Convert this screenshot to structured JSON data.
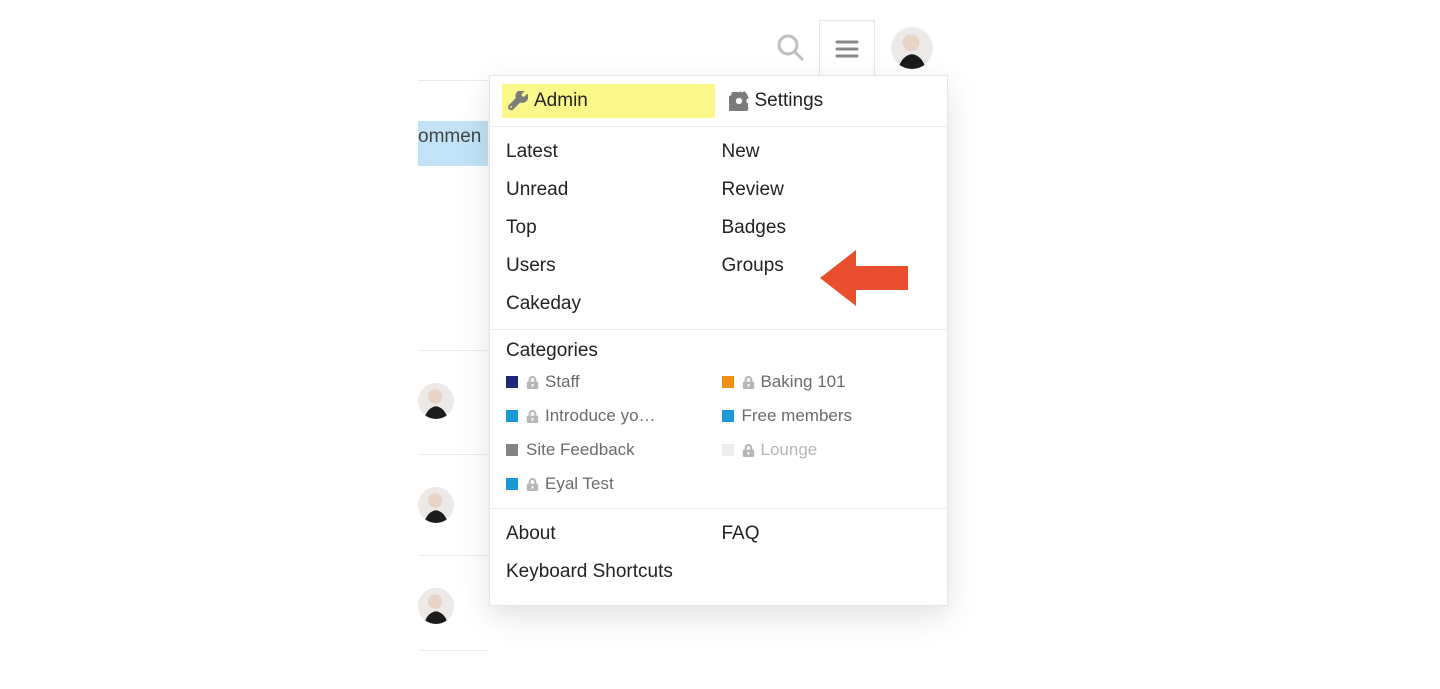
{
  "background": {
    "pill_text": "ommen",
    "row_dividers": [
      350,
      454,
      555,
      650
    ]
  },
  "header": {
    "search_icon": "search-icon",
    "menu_icon": "hamburger-icon",
    "avatar_icon": "user-avatar"
  },
  "panel": {
    "top": {
      "admin_icon": "wrench-icon",
      "admin_label": "Admin",
      "settings_icon": "gear-icon",
      "settings_label": "Settings"
    },
    "nav_left": [
      "Latest",
      "Unread",
      "Top",
      "Users",
      "Cakeday"
    ],
    "nav_right": [
      "New",
      "Review",
      "Badges",
      "Groups"
    ],
    "categories_heading": "Categories",
    "categories_left": [
      {
        "color": "#23247c",
        "locked": true,
        "label": "Staff"
      },
      {
        "color": "#1899d6",
        "locked": true,
        "label": "Introduce yo…"
      },
      {
        "color": "#848484",
        "locked": false,
        "label": "Site Feedback"
      },
      {
        "color": "#1899d6",
        "locked": true,
        "label": "Eyal Test"
      }
    ],
    "categories_right": [
      {
        "color": "#f09015",
        "locked": true,
        "label": "Baking 101"
      },
      {
        "color": "#1899d6",
        "locked": false,
        "label": "Free members"
      },
      {
        "color": "#ededed",
        "locked": true,
        "label": "Lounge",
        "dim": true
      }
    ],
    "footer_left": [
      "About",
      "Keyboard Shortcuts"
    ],
    "footer_right": [
      "FAQ"
    ]
  },
  "annotation": {
    "arrow_points_to": "Groups",
    "arrow_color": "#e94f2e"
  }
}
